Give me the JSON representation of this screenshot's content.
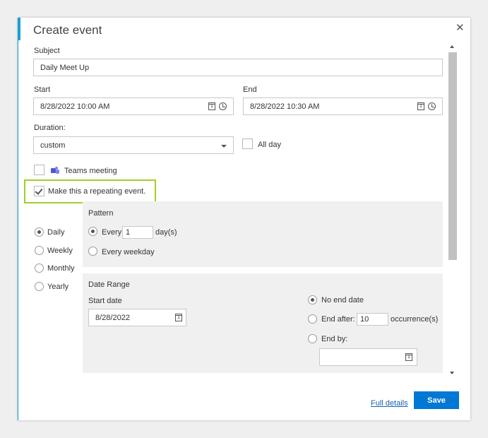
{
  "dialog": {
    "title": "Create event",
    "close_glyph": "✕",
    "close_icon": "close-icon"
  },
  "subject": {
    "label": "Subject",
    "value": "Daily Meet Up"
  },
  "start": {
    "label": "Start",
    "value": "8/28/2022 10:00 AM"
  },
  "end": {
    "label": "End",
    "value": "8/28/2022 10:30 AM"
  },
  "duration": {
    "label": "Duration:",
    "value": "custom"
  },
  "all_day": {
    "label": "All day",
    "checked": false
  },
  "teams_meeting": {
    "label": "Teams meeting",
    "checked": false,
    "icon": "teams-icon"
  },
  "repeating": {
    "label": "Make this a repeating event.",
    "checked": true,
    "highlight_color": "#9fcf2a"
  },
  "frequency": {
    "options": [
      {
        "label": "Daily",
        "selected": true
      },
      {
        "label": "Weekly",
        "selected": false
      },
      {
        "label": "Monthly",
        "selected": false
      },
      {
        "label": "Yearly",
        "selected": false
      }
    ]
  },
  "pattern": {
    "heading": "Pattern",
    "every_label": "Every",
    "every_value": "1",
    "unit_label": "day(s)",
    "weekday_label": "Every weekday",
    "every_selected": true
  },
  "date_range": {
    "heading": "Date Range",
    "start_label": "Start date",
    "start_value": "8/28/2022",
    "no_end_label": "No end date",
    "end_after_label": "End after:",
    "end_after_value": "10",
    "occurrence_label": "occurrence(s)",
    "end_by_label": "End by:",
    "end_by_value": "",
    "selected": "no_end"
  },
  "footer": {
    "full_details": "Full details",
    "save": "Save"
  },
  "colors": {
    "accent": "#1aa0d8",
    "save_button": "#0078d4",
    "link": "#1a5fb4"
  }
}
